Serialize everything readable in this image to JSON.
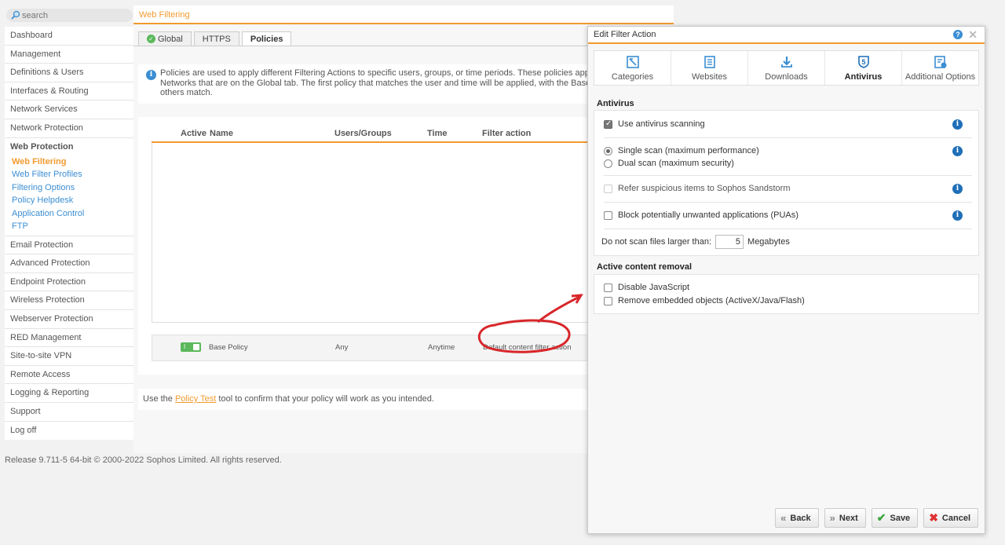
{
  "search": {
    "placeholder": "search"
  },
  "sidebar": {
    "items_top": [
      "Dashboard",
      "Management",
      "Definitions & Users",
      "Interfaces & Routing",
      "Network Services",
      "Network Protection"
    ],
    "group_title": "Web Protection",
    "sub_items": [
      "Web Filtering",
      "Web Filter Profiles",
      "Filtering Options",
      "Policy Helpdesk",
      "Application Control",
      "FTP"
    ],
    "items_bottom": [
      "Email Protection",
      "Advanced Protection",
      "Endpoint Protection",
      "Wireless Protection",
      "Webserver Protection",
      "RED Management",
      "Site-to-site VPN",
      "Remote Access",
      "Logging & Reporting",
      "Support",
      "Log off"
    ]
  },
  "main": {
    "header": "Web Filtering",
    "tabs": [
      "Global",
      "HTTPS",
      "Policies"
    ],
    "info_lines": [
      "Policies are used to apply different Filtering Actions to specific users, groups, or time periods. These policies apply to t",
      "Networks that are on the Global tab. The first policy that matches the user and time will be applied, with the Base Polic",
      "others match."
    ],
    "table": {
      "columns": [
        "Active",
        "Name",
        "Users/Groups",
        "Time",
        "Filter action"
      ],
      "base_row": {
        "toggle_text": "I",
        "name": "Base Policy",
        "users": "Any",
        "time": "Anytime",
        "filter_action": "Default content filter action"
      }
    },
    "footer": {
      "prefix": "Use the ",
      "link": "Policy Test",
      "suffix": " tool to confirm that your policy will work as you intended."
    }
  },
  "copyright": "Release 9.711-5 64-bit  © 2000-2022 Sophos Limited. All rights reserved.",
  "dialog": {
    "title": "Edit Filter Action",
    "help_label": "?",
    "tabs": [
      "Categories",
      "Websites",
      "Downloads",
      "Antivirus",
      "Additional Options"
    ],
    "antivirus_section": "Antivirus",
    "options": {
      "use_av": "Use antivirus scanning",
      "single_scan": "Single scan (maximum performance)",
      "dual_scan": "Dual scan (maximum security)",
      "sandstorm": "Refer suspicious items to Sophos Sandstorm",
      "pua": "Block potentially unwanted applications (PUAs)",
      "size_label": "Do not scan files larger than:",
      "size_value": "5",
      "size_unit": "Megabytes"
    },
    "active_content_section": "Active content removal",
    "active_content": {
      "js": "Disable JavaScript",
      "embedded": "Remove embedded objects (ActiveX/Java/Flash)"
    },
    "buttons": {
      "back": "Back",
      "next": "Next",
      "save": "Save",
      "cancel": "Cancel"
    }
  },
  "colors": {
    "accent": "#f29a2e",
    "link": "#3b8ed3",
    "info": "#1f6fb8",
    "toggle_on": "#5bb85b",
    "annotation": "#d8262a"
  }
}
